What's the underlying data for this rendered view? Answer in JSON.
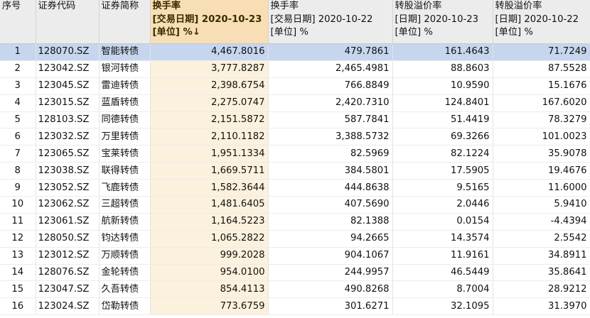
{
  "table": {
    "headers": [
      {
        "lines": [
          "序号"
        ]
      },
      {
        "lines": [
          "证券代码"
        ]
      },
      {
        "lines": [
          "证券简称"
        ]
      },
      {
        "lines": [
          "换手率",
          "[交易日期] 2020-10-23",
          "[单位] %↓"
        ]
      },
      {
        "lines": [
          "换手率",
          "[交易日期] 2020-10-22",
          "[单位] %"
        ]
      },
      {
        "lines": [
          "转股溢价率",
          "[日期] 2020-10-23",
          "[单位] %"
        ]
      },
      {
        "lines": [
          "转股溢价率",
          "[日期] 2020-10-22",
          "[单位] %"
        ]
      }
    ],
    "sorted_column": 3,
    "selected_row": 0,
    "rows": [
      [
        "1",
        "128070.SZ",
        "智能转债",
        "4,467.8016",
        "479.7861",
        "161.4643",
        "71.7249"
      ],
      [
        "2",
        "123042.SZ",
        "银河转债",
        "3,777.8287",
        "2,465.4981",
        "88.8603",
        "87.5528"
      ],
      [
        "3",
        "123045.SZ",
        "雷迪转债",
        "2,398.6754",
        "766.8849",
        "10.9590",
        "15.1676"
      ],
      [
        "4",
        "123015.SZ",
        "蓝盾转债",
        "2,275.0747",
        "2,420.7310",
        "124.8401",
        "167.6020"
      ],
      [
        "5",
        "128103.SZ",
        "同德转债",
        "2,151.5872",
        "587.7841",
        "51.4419",
        "78.3279"
      ],
      [
        "6",
        "123032.SZ",
        "万里转债",
        "2,110.1182",
        "3,388.5732",
        "69.3266",
        "101.0023"
      ],
      [
        "7",
        "123065.SZ",
        "宝莱转债",
        "1,951.1334",
        "82.5969",
        "82.1224",
        "35.9078"
      ],
      [
        "8",
        "123038.SZ",
        "联得转债",
        "1,669.5711",
        "384.5801",
        "17.5905",
        "19.4676"
      ],
      [
        "9",
        "123052.SZ",
        "飞鹿转债",
        "1,582.3644",
        "444.8638",
        "9.5165",
        "11.6000"
      ],
      [
        "10",
        "123062.SZ",
        "三超转债",
        "1,481.6405",
        "407.5690",
        "2.0446",
        "5.9410"
      ],
      [
        "11",
        "123061.SZ",
        "航新转债",
        "1,164.5223",
        "82.1388",
        "0.0154",
        "-4.4394"
      ],
      [
        "12",
        "128050.SZ",
        "钧达转债",
        "1,065.2822",
        "94.2665",
        "14.3574",
        "2.5542"
      ],
      [
        "13",
        "123012.SZ",
        "万顺转债",
        "999.2028",
        "904.1067",
        "11.9161",
        "34.8911"
      ],
      [
        "14",
        "128076.SZ",
        "金轮转债",
        "954.0100",
        "244.9957",
        "46.5449",
        "35.8641"
      ],
      [
        "15",
        "123047.SZ",
        "久吾转债",
        "854.4113",
        "490.8268",
        "8.7004",
        "28.9212"
      ],
      [
        "16",
        "123024.SZ",
        "岱勒转债",
        "773.6759",
        "301.6271",
        "32.1095",
        "31.3970"
      ]
    ]
  }
}
